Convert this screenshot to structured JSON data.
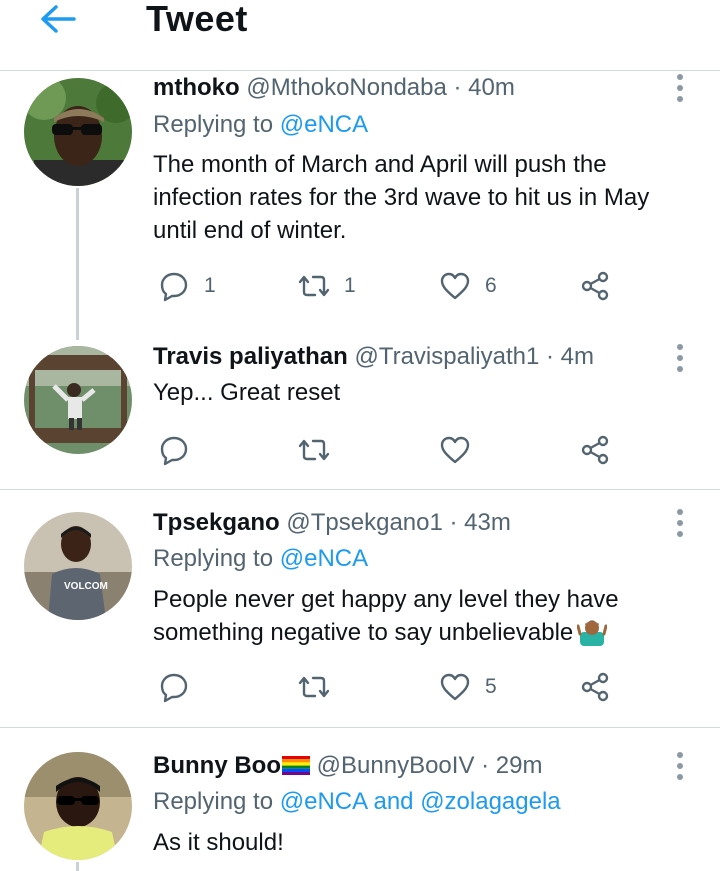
{
  "header": {
    "title": "Tweet"
  },
  "tweets": [
    {
      "name": "mthoko",
      "handle": "@MthokoNondaba · 40m",
      "reply_prefix": "Replying to ",
      "reply_to": "@eNCA",
      "text": "The month of March and April will push the infection rates for the 3rd wave to hit us in May until end of winter.",
      "replies": "1",
      "retweets": "1",
      "likes": "6"
    },
    {
      "name": "Travis paliyathan",
      "handle": "@Travispaliyath1 · 4m",
      "text": "Yep... Great reset",
      "replies": "",
      "retweets": "",
      "likes": ""
    },
    {
      "name": "Tpsekgano",
      "handle": "@Tpsekgano1 · 43m",
      "reply_prefix": "Replying to ",
      "reply_to": "@eNCA",
      "text": "People never get happy any level they have something negative to say unbelievable",
      "replies": "",
      "retweets": "",
      "likes": "5"
    },
    {
      "name": "Bunny Boo",
      "handle": "@BunnyBooIV · 29m",
      "reply_prefix": "Replying to ",
      "reply_to": "@eNCA and @zolagagela",
      "text": "As it should!"
    }
  ],
  "colors": {
    "accent": "#1d9bf0",
    "secondary_text": "#536471",
    "icon": "#536471"
  },
  "icons": [
    "back-arrow-icon",
    "more-vertical-icon",
    "reply-icon",
    "retweet-icon",
    "like-icon",
    "share-icon",
    "rainbow-flag-icon",
    "shrug-emoji-icon"
  ]
}
